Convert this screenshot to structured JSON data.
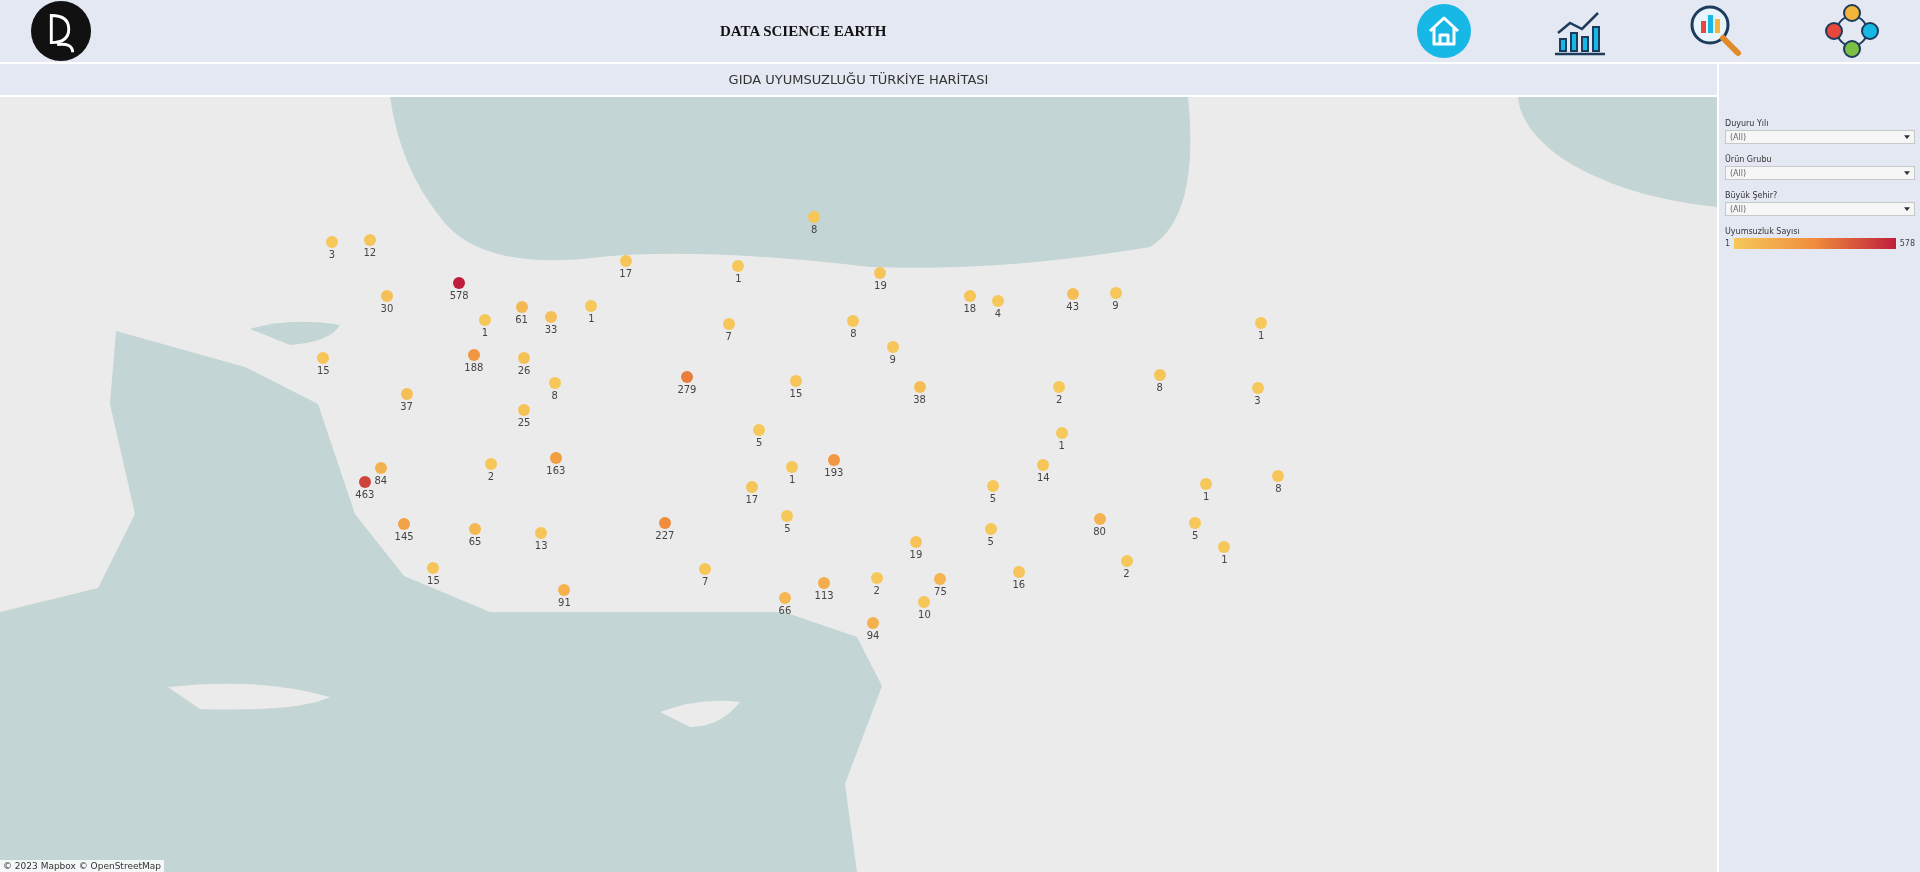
{
  "header": {
    "title": "DATA SCIENCE EARTH",
    "nav": [
      {
        "kind": "home"
      },
      {
        "kind": "chart"
      },
      {
        "kind": "search"
      },
      {
        "kind": "team"
      }
    ]
  },
  "map": {
    "title": "GIDA UYUMSUZLUĞU TÜRKİYE HARİTASI",
    "attribution": "© 2023 Mapbox © OpenStreetMap",
    "pins": [
      {
        "value": "8"
      },
      {
        "value": "3"
      },
      {
        "value": "12"
      },
      {
        "value": "17"
      },
      {
        "value": "1"
      },
      {
        "value": "19"
      },
      {
        "value": "578"
      },
      {
        "value": "30"
      },
      {
        "value": "18"
      },
      {
        "value": "4"
      },
      {
        "value": "43"
      },
      {
        "value": "9"
      },
      {
        "value": "61"
      },
      {
        "value": "1"
      },
      {
        "value": "1"
      },
      {
        "value": "33"
      },
      {
        "value": "7"
      },
      {
        "value": "8"
      },
      {
        "value": "1"
      },
      {
        "value": "9"
      },
      {
        "value": "15"
      },
      {
        "value": "188"
      },
      {
        "value": "26"
      },
      {
        "value": "8"
      },
      {
        "value": "279"
      },
      {
        "value": "15"
      },
      {
        "value": "38"
      },
      {
        "value": "2"
      },
      {
        "value": "8"
      },
      {
        "value": "3"
      },
      {
        "value": "37"
      },
      {
        "value": "25"
      },
      {
        "value": "5"
      },
      {
        "value": "1"
      },
      {
        "value": "84"
      },
      {
        "value": "2"
      },
      {
        "value": "163"
      },
      {
        "value": "1"
      },
      {
        "value": "193"
      },
      {
        "value": "14"
      },
      {
        "value": "463"
      },
      {
        "value": "17"
      },
      {
        "value": "5"
      },
      {
        "value": "1"
      },
      {
        "value": "8"
      },
      {
        "value": "145"
      },
      {
        "value": "65"
      },
      {
        "value": "13"
      },
      {
        "value": "227"
      },
      {
        "value": "5"
      },
      {
        "value": "5"
      },
      {
        "value": "80"
      },
      {
        "value": "5"
      },
      {
        "value": "19"
      },
      {
        "value": "1"
      },
      {
        "value": "15"
      },
      {
        "value": "7"
      },
      {
        "value": "113"
      },
      {
        "value": "2"
      },
      {
        "value": "75"
      },
      {
        "value": "16"
      },
      {
        "value": "2"
      },
      {
        "value": "91"
      },
      {
        "value": "66"
      },
      {
        "value": "10"
      },
      {
        "value": "94"
      }
    ]
  },
  "filters": [
    {
      "label": "Duyuru Yılı",
      "value": "(All)"
    },
    {
      "label": "Ürün Grubu",
      "value": "(All)"
    },
    {
      "label": "Büyük Şehir?",
      "value": "(All)"
    }
  ],
  "legend": {
    "title": "Uyumsuzluk Sayısı",
    "min": "1",
    "max": "578"
  }
}
